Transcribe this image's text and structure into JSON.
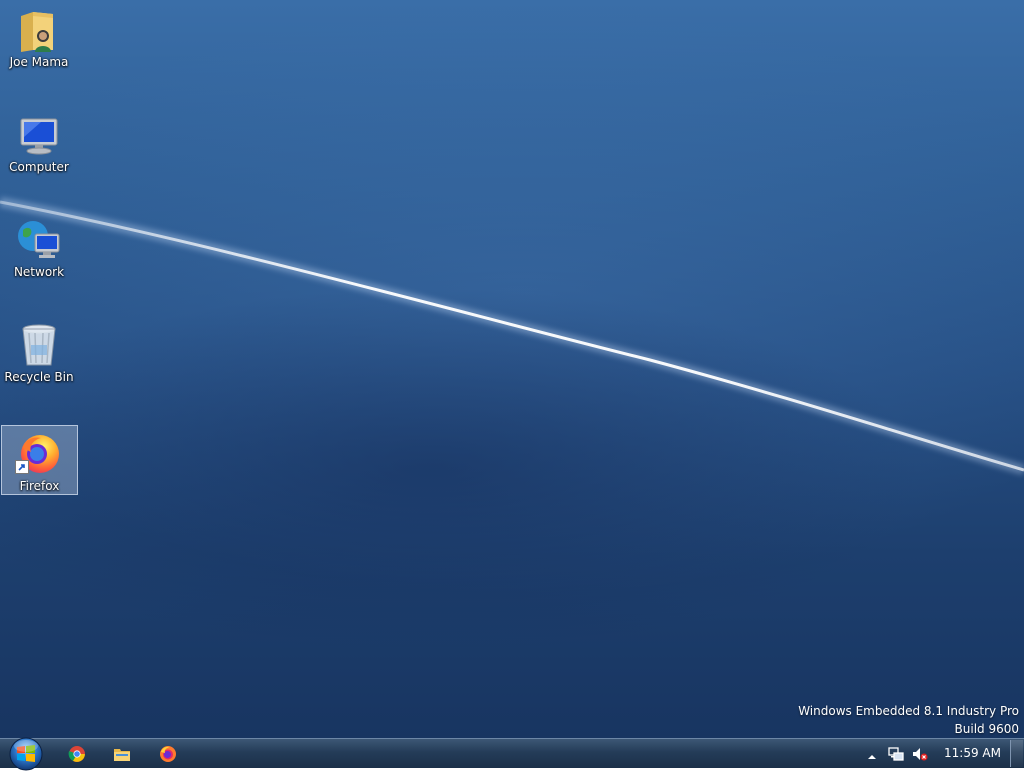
{
  "desktop": {
    "icons": [
      {
        "label": "Joe Mama",
        "icon": "user-folder-icon"
      },
      {
        "label": "Computer",
        "icon": "computer-icon"
      },
      {
        "label": "Network",
        "icon": "network-icon"
      },
      {
        "label": "Recycle Bin",
        "icon": "recycle-bin-icon"
      },
      {
        "label": "Firefox",
        "icon": "firefox-icon",
        "selected": true
      }
    ],
    "watermark": {
      "line1": "Windows Embedded 8.1 Industry Pro",
      "line2": "Build 9600"
    }
  },
  "taskbar": {
    "start_icon": "windows-start-orb-icon",
    "pinned": [
      {
        "icon": "chrome-icon"
      },
      {
        "icon": "file-explorer-icon"
      },
      {
        "icon": "firefox-icon"
      }
    ],
    "tray": {
      "icons": [
        "show-hidden-icons-chevron",
        "network-status-icon",
        "volume-muted-icon"
      ],
      "clock": "11:59 AM"
    }
  },
  "colors": {
    "desktop_top": "#3a6ea8",
    "desktop_bottom": "#183561",
    "taskbar": "#243c58"
  }
}
